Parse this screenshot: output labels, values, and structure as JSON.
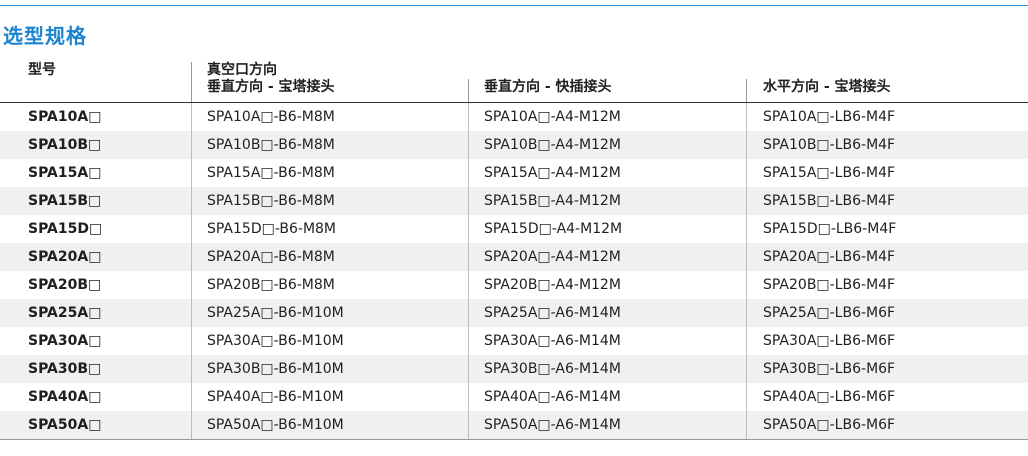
{
  "section_title": "选型规格",
  "header": {
    "model": "型号",
    "group_title": "真空口方向",
    "col1": "垂直方向 - 宝塔接头",
    "col2": "垂直方向 - 快插接头",
    "col3": "水平方向 - 宝塔接头"
  },
  "rows": [
    {
      "model": "SPA10A□",
      "c1": "SPA10A□-B6-M8M",
      "c2": "SPA10A□-A4-M12M",
      "c3": "SPA10A□-LB6-M4F"
    },
    {
      "model": "SPA10B□",
      "c1": "SPA10B□-B6-M8M",
      "c2": "SPA10B□-A4-M12M",
      "c3": "SPA10B□-LB6-M4F"
    },
    {
      "model": "SPA15A□",
      "c1": "SPA15A□-B6-M8M",
      "c2": "SPA15A□-A4-M12M",
      "c3": "SPA15A□-LB6-M4F"
    },
    {
      "model": "SPA15B□",
      "c1": "SPA15B□-B6-M8M",
      "c2": "SPA15B□-A4-M12M",
      "c3": "SPA15B□-LB6-M4F"
    },
    {
      "model": "SPA15D□",
      "c1": "SPA15D□-B6-M8M",
      "c2": "SPA15D□-A4-M12M",
      "c3": "SPA15D□-LB6-M4F"
    },
    {
      "model": "SPA20A□",
      "c1": "SPA20A□-B6-M8M",
      "c2": "SPA20A□-A4-M12M",
      "c3": "SPA20A□-LB6-M4F"
    },
    {
      "model": "SPA20B□",
      "c1": "SPA20B□-B6-M8M",
      "c2": "SPA20B□-A4-M12M",
      "c3": "SPA20B□-LB6-M4F"
    },
    {
      "model": "SPA25A□",
      "c1": "SPA25A□-B6-M10M",
      "c2": "SPA25A□-A6-M14M",
      "c3": "SPA25A□-LB6-M6F"
    },
    {
      "model": "SPA30A□",
      "c1": "SPA30A□-B6-M10M",
      "c2": "SPA30A□-A6-M14M",
      "c3": "SPA30A□-LB6-M6F"
    },
    {
      "model": "SPA30B□",
      "c1": "SPA30B□-B6-M10M",
      "c2": "SPA30B□-A6-M14M",
      "c3": "SPA30B□-LB6-M6F"
    },
    {
      "model": "SPA40A□",
      "c1": "SPA40A□-B6-M10M",
      "c2": "SPA40A□-A6-M14M",
      "c3": "SPA40A□-LB6-M6F"
    },
    {
      "model": "SPA50A□",
      "c1": "SPA50A□-B6-M10M",
      "c2": "SPA50A□-A6-M14M",
      "c3": "SPA50A□-LB6-M6F"
    }
  ],
  "colors": {
    "accent": "#1a84d0",
    "row_alt": "#f0f0f0"
  }
}
